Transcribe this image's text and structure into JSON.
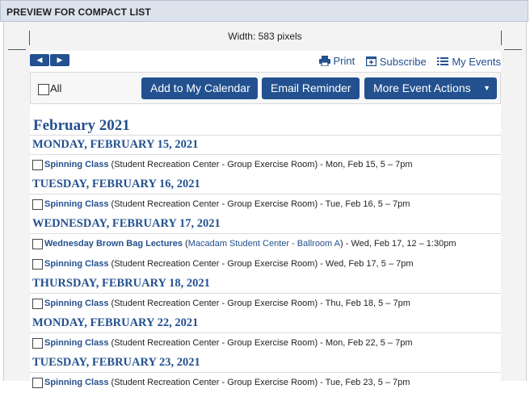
{
  "panel": {
    "title": "PREVIEW FOR COMPACT LIST",
    "width_label": "Width: 583 pixels"
  },
  "nav": {
    "prev_icon": "◀",
    "next_icon": "▶"
  },
  "tools": {
    "print": "Print",
    "subscribe": "Subscribe",
    "my_events": "My Events"
  },
  "actions": {
    "all_label": "All",
    "add_calendar": "Add to My Calendar",
    "email_reminder": "Email Reminder",
    "more_actions": "More Event Actions",
    "more_caret": "▼"
  },
  "month": "February 2021",
  "days": [
    {
      "heading": "MONDAY, FEBRUARY 15, 2021",
      "events": [
        {
          "title": "Spinning Class",
          "loc_open": " (",
          "location": "Student Recreation Center - Group Exercise Room",
          "loc_close": ")",
          "time": " - Mon, Feb 15, 5 – 7pm"
        }
      ]
    },
    {
      "heading": "TUESDAY, FEBRUARY 16, 2021",
      "events": [
        {
          "title": "Spinning Class",
          "loc_open": " (",
          "location": "Student Recreation Center - Group Exercise Room",
          "loc_close": ")",
          "time": " - Tue, Feb 16, 5 – 7pm"
        }
      ]
    },
    {
      "heading": "WEDNESDAY, FEBRUARY 17, 2021",
      "events": [
        {
          "title": "Wednesday Brown Bag Lectures",
          "loc_open": " (",
          "location": "Macadam Student Center - Ballroom A",
          "loc_close": ")",
          "time": " - Wed, Feb 17, 12 – 1:30pm",
          "loc_link": true
        },
        {
          "title": "Spinning Class",
          "loc_open": " (",
          "location": "Student Recreation Center - Group Exercise Room",
          "loc_close": ")",
          "time": " - Wed, Feb 17, 5 – 7pm"
        }
      ]
    },
    {
      "heading": "THURSDAY, FEBRUARY 18, 2021",
      "events": [
        {
          "title": "Spinning Class",
          "loc_open": " (",
          "location": "Student Recreation Center - Group Exercise Room",
          "loc_close": ")",
          "time": " - Thu, Feb 18, 5 – 7pm"
        }
      ]
    },
    {
      "heading": "MONDAY, FEBRUARY 22, 2021",
      "events": [
        {
          "title": "Spinning Class",
          "loc_open": " (",
          "location": "Student Recreation Center - Group Exercise Room",
          "loc_close": ")",
          "time": " - Mon, Feb 22, 5 – 7pm"
        }
      ]
    },
    {
      "heading": "TUESDAY, FEBRUARY 23, 2021",
      "events": [
        {
          "title": "Spinning Class",
          "loc_open": " (",
          "location": "Student Recreation Center - Group Exercise Room",
          "loc_close": ")",
          "time": " - Tue, Feb 23, 5 – 7pm"
        }
      ]
    }
  ]
}
